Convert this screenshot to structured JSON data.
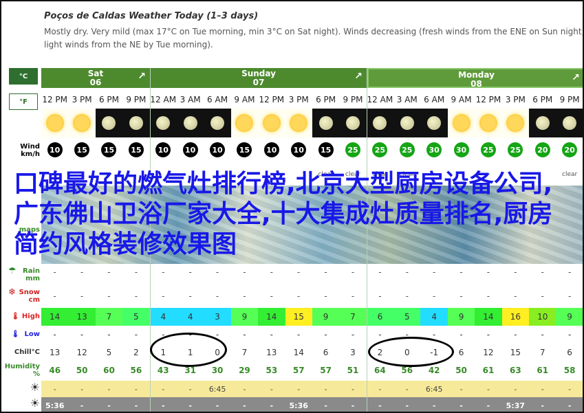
{
  "title": "Poços de Caldas Weather Today (1–3 days)",
  "summary": "Mostly dry. Very mild (max 17°C on Tue morning, min 3°C on Sat night). Winds decreasing (fresh winds from the ENE on Sun night, light winds from the NE by Tue morning).",
  "units": {
    "celsius": "°C",
    "fahrenheit": "°F"
  },
  "labels": {
    "wind": "Wind",
    "wind_unit": "km/h",
    "maps": "maps",
    "rain": "Rain",
    "rain_unit": "mm",
    "snow": "Snow",
    "snow_unit": "cm",
    "high": "High",
    "low": "Low",
    "chill": "Chill°C",
    "humidity": "Humidity",
    "humidity_unit": "%"
  },
  "days": [
    {
      "name": "Sat",
      "date": "06"
    },
    {
      "name": "Sunday",
      "date": "07"
    },
    {
      "name": "Monday",
      "date": "08"
    }
  ],
  "expand_symbol": "↗",
  "times": [
    "12 PM",
    "3 PM",
    "6 PM",
    "9 PM",
    "12 AM",
    "3 AM",
    "6 AM",
    "9 AM",
    "12 PM",
    "3 PM",
    "6 PM",
    "9 PM",
    "12 AM",
    "3 AM",
    "6 AM",
    "9 AM",
    "12 PM",
    "3 PM",
    "6 PM",
    "9 PM"
  ],
  "sky": [
    "day",
    "day",
    "night",
    "night",
    "night",
    "night",
    "night",
    "day",
    "day",
    "day",
    "night",
    "night",
    "night",
    "night",
    "night",
    "day",
    "day",
    "day",
    "night",
    "night"
  ],
  "sky_icons": [
    "sun",
    "sun",
    "moon",
    "moon",
    "moon",
    "moon",
    "moon",
    "sun",
    "sun",
    "sun",
    "moon",
    "moon",
    "moon",
    "moon",
    "moon",
    "sun",
    "sun",
    "sun",
    "moon",
    "moon"
  ],
  "wind": [
    "10",
    "15",
    "15",
    "15",
    "10",
    "10",
    "10",
    "15",
    "10",
    "10",
    "15",
    "25",
    "25",
    "25",
    "30",
    "30",
    "25",
    "25",
    "20",
    "20"
  ],
  "wind_strong": [
    false,
    false,
    false,
    false,
    false,
    false,
    false,
    false,
    false,
    false,
    false,
    true,
    true,
    true,
    true,
    true,
    true,
    true,
    true,
    true
  ],
  "desc": [
    "",
    "",
    "",
    "",
    "",
    "",
    "",
    "",
    "",
    "",
    "clear",
    "clear",
    "clear",
    "clear",
    "",
    "",
    "",
    "",
    "",
    "clear"
  ],
  "rain": [
    "-",
    "-",
    "-",
    "-",
    "-",
    "-",
    "-",
    "-",
    "-",
    "-",
    "-",
    "-",
    "-",
    "-",
    "-",
    "-",
    "-",
    "-",
    "-",
    "-"
  ],
  "snow": [
    "-",
    "-",
    "-",
    "-",
    "-",
    "-",
    "-",
    "-",
    "-",
    "-",
    "-",
    "-",
    "-",
    "-",
    "-",
    "-",
    "-",
    "-",
    "-",
    "-"
  ],
  "high": [
    "14",
    "13",
    "7",
    "5",
    "4",
    "4",
    "3",
    "9",
    "14",
    "15",
    "9",
    "7",
    "6",
    "5",
    "4",
    "9",
    "14",
    "16",
    "10",
    "9"
  ],
  "high_colors": [
    "#33ee33",
    "#33ee33",
    "#55ff55",
    "#44ff66",
    "#22ddff",
    "#22ddff",
    "#22ddff",
    "#55ff55",
    "#33ee33",
    "#ffee22",
    "#55ff55",
    "#55ff55",
    "#44ff66",
    "#44ff66",
    "#22ddff",
    "#55ff55",
    "#33ee33",
    "#ffee22",
    "#88ee22",
    "#55ff55"
  ],
  "low": [
    "-",
    "-",
    "-",
    "-",
    "-",
    "-",
    "-",
    "-",
    "-",
    "-",
    "-",
    "-",
    "-",
    "-",
    "-",
    "-",
    "-",
    "-",
    "-",
    "-"
  ],
  "chill": [
    "13",
    "12",
    "5",
    "2",
    "1",
    "1",
    "0",
    "7",
    "13",
    "14",
    "6",
    "3",
    "2",
    "0",
    "-1",
    "6",
    "12",
    "15",
    "7",
    "6"
  ],
  "humidity": [
    "46",
    "50",
    "60",
    "56",
    "43",
    "31",
    "30",
    "29",
    "53",
    "57",
    "57",
    "51",
    "64",
    "56",
    "42",
    "50",
    "61",
    "63",
    "61",
    "58"
  ],
  "sunrise": [
    "-",
    "-",
    "-",
    "-",
    "-",
    "-",
    "6:45",
    "-",
    "-",
    "-",
    "-",
    "-",
    "-",
    "-",
    "6:45",
    "-",
    "-",
    "-",
    "-",
    "-"
  ],
  "sunset": [
    "5:36",
    "-",
    "-",
    "-",
    "-",
    "-",
    "-",
    "-",
    "-",
    "5:36",
    "-",
    "-",
    "-",
    "-",
    "-",
    "-",
    "-",
    "5:37",
    "-",
    "-"
  ],
  "overlay_text": "口碑最好的燃气灶排行榜,北京大型厨房设备公司,广东佛山卫浴厂家大全,十大集成灶质量排名,厨房简约风格装修效果图"
}
